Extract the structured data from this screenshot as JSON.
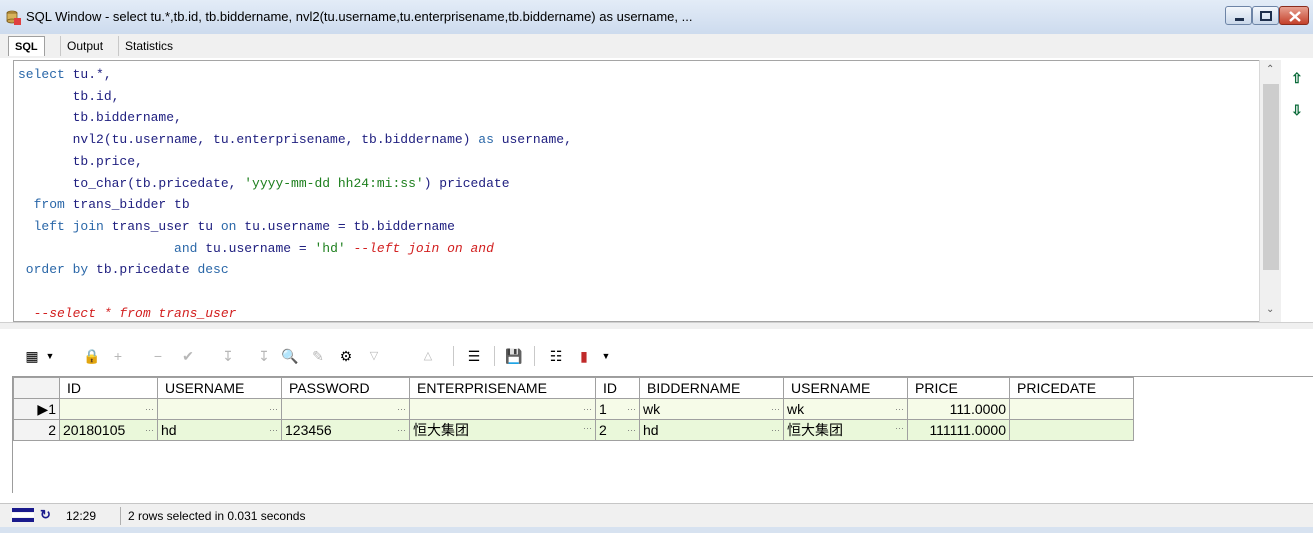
{
  "window": {
    "title": "SQL Window - select tu.*,tb.id, tb.biddername, nvl2(tu.username,tu.enterprisename,tb.biddername) as username, ...",
    "icons": [
      "sql-window-icon",
      "minimize-icon",
      "maximize-icon",
      "close-icon"
    ]
  },
  "tabs": [
    {
      "label": "SQL",
      "active": true
    },
    {
      "label": "Output",
      "active": false
    },
    {
      "label": "Statistics",
      "active": false
    }
  ],
  "editor": {
    "lines": {
      "l1a": "select",
      "l1b": " tu.*,",
      "l2": "       tb.id,",
      "l3": "       tb.biddername,",
      "l4a": "       nvl2(tu.username, tu.enterprisename, tb.biddername) ",
      "l4b": "as",
      "l4c": " username,",
      "l5": "       tb.price,",
      "l6a": "       to_char(tb.pricedate, ",
      "l6b": "'yyyy-mm-dd hh24:mi:ss'",
      "l6c": ") pricedate",
      "l7a": "  from",
      "l7b": " trans_bidder tb",
      "l8a": "  left join",
      "l8b": " trans_user tu ",
      "l8c": "on",
      "l8d": " tu.username = tb.biddername",
      "l9a": "                    and",
      "l9b": " tu.username = ",
      "l9c": "'hd'",
      "l9d": " --left join on and",
      "l10a": " order by",
      "l10b": " tb.pricedate ",
      "l10c": "desc",
      "l12": "  --select * from trans_user"
    }
  },
  "results": {
    "columns": [
      "ID",
      "USERNAME",
      "PASSWORD",
      "ENTERPRISENAME",
      "ID",
      "BIDDERNAME",
      "USERNAME",
      "PRICE",
      "PRICEDATE"
    ],
    "rows": [
      {
        "num": "1",
        "cells": [
          "",
          "",
          "",
          "",
          "1",
          "wk",
          "wk",
          "111.0000",
          ""
        ]
      },
      {
        "num": "2",
        "cells": [
          "20180105",
          "hd",
          "123456",
          "恒大集团",
          "2",
          "hd",
          "恒大集团",
          "111111.0000",
          ""
        ]
      }
    ]
  },
  "status": {
    "time": "12:29",
    "message": "2 rows selected in 0.031 seconds"
  },
  "colors": {
    "keyword": "#2a67a8",
    "string": "#1d7f1d",
    "comment": "#d21f1f",
    "row1_bg": "#f6fbe8",
    "row2_bg": "#eaf8da"
  }
}
